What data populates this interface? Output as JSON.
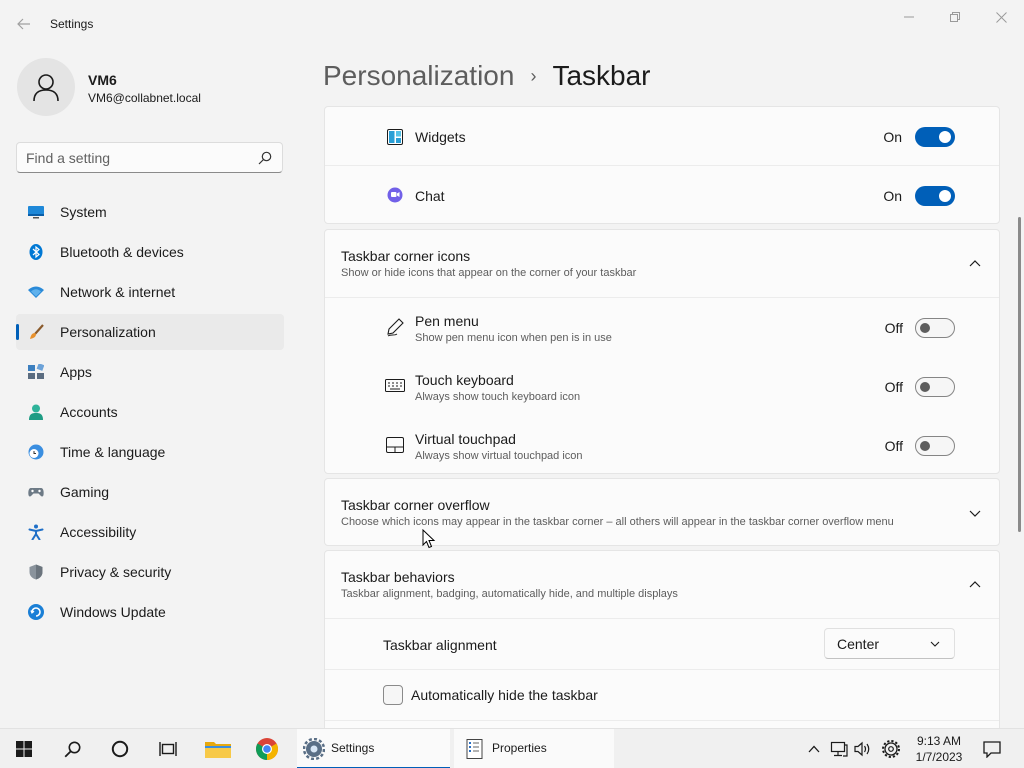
{
  "window": {
    "app_title": "Settings",
    "back_icon": "back-arrow-icon",
    "controls": [
      "minimize-icon",
      "restore-icon",
      "close-icon"
    ]
  },
  "profile": {
    "name": "VM6",
    "email": "VM6@collabnet.local",
    "avatar_icon": "person-icon"
  },
  "search": {
    "placeholder": "Find a setting",
    "value": ""
  },
  "sidebar": {
    "items": [
      {
        "label": "System",
        "icon": "monitor-icon",
        "selected": false
      },
      {
        "label": "Bluetooth & devices",
        "icon": "bluetooth-icon",
        "selected": false
      },
      {
        "label": "Network & internet",
        "icon": "wifi-icon",
        "selected": false
      },
      {
        "label": "Personalization",
        "icon": "paintbrush-icon",
        "selected": true
      },
      {
        "label": "Apps",
        "icon": "apps-icon",
        "selected": false
      },
      {
        "label": "Accounts",
        "icon": "account-icon",
        "selected": false
      },
      {
        "label": "Time & language",
        "icon": "clock-globe-icon",
        "selected": false
      },
      {
        "label": "Gaming",
        "icon": "gamepad-icon",
        "selected": false
      },
      {
        "label": "Accessibility",
        "icon": "accessibility-icon",
        "selected": false
      },
      {
        "label": "Privacy & security",
        "icon": "shield-icon",
        "selected": false
      },
      {
        "label": "Windows Update",
        "icon": "update-icon",
        "selected": false
      }
    ]
  },
  "breadcrumb": {
    "parent": "Personalization",
    "separator": "›",
    "current": "Taskbar"
  },
  "taskbar_items": [
    {
      "label": "Widgets",
      "state": "On",
      "on": true,
      "icon": "widgets-icon"
    },
    {
      "label": "Chat",
      "state": "On",
      "on": true,
      "icon": "chat-icon"
    }
  ],
  "corner_icons": {
    "title": "Taskbar corner icons",
    "subtitle": "Show or hide icons that appear on the corner of your taskbar",
    "expanded": true,
    "items": [
      {
        "label": "Pen menu",
        "sub": "Show pen menu icon when pen is in use",
        "state": "Off",
        "on": false,
        "icon": "pen-icon"
      },
      {
        "label": "Touch keyboard",
        "sub": "Always show touch keyboard icon",
        "state": "Off",
        "on": false,
        "icon": "keyboard-icon"
      },
      {
        "label": "Virtual touchpad",
        "sub": "Always show virtual touchpad icon",
        "state": "Off",
        "on": false,
        "icon": "touchpad-icon"
      }
    ]
  },
  "corner_overflow": {
    "title": "Taskbar corner overflow",
    "subtitle": "Choose which icons may appear in the taskbar corner – all others will appear in the taskbar corner overflow menu",
    "expanded": false
  },
  "behaviors": {
    "title": "Taskbar behaviors",
    "subtitle": "Taskbar alignment, badging, automatically hide, and multiple displays",
    "expanded": true,
    "alignment_label": "Taskbar alignment",
    "alignment_value": "Center",
    "autohide_label": "Automatically hide the taskbar",
    "autohide_checked": false
  },
  "os_taskbar": {
    "pinned": [
      "windows-start-icon",
      "search-icon",
      "cortana-circle-icon",
      "task-view-icon",
      "file-explorer-icon",
      "chrome-icon"
    ],
    "apps": [
      {
        "label": "Settings",
        "icon": "settings-gear-icon",
        "active": true
      },
      {
        "label": "Properties",
        "icon": "properties-icon",
        "active": false
      }
    ],
    "tray": [
      "chevron-up-icon",
      "network-icon",
      "volume-icon",
      "settings-icon"
    ],
    "time": "9:13 AM",
    "date": "1/7/2023",
    "notification_icon": "notification-icon"
  },
  "colors": {
    "accent": "#005fb8",
    "background": "#f3f3f3",
    "card": "#fbfbfb"
  }
}
